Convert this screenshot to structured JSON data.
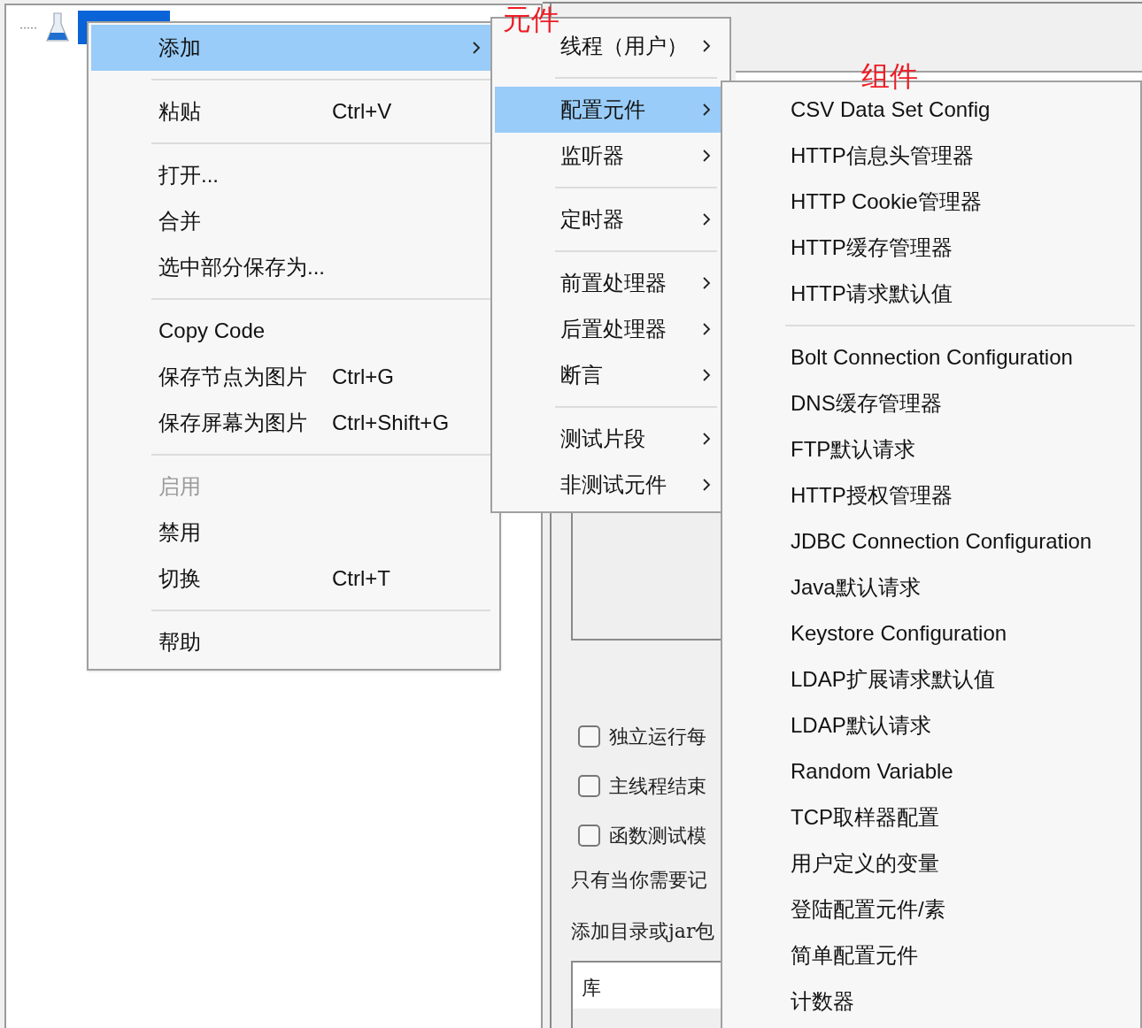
{
  "tree": {
    "connector": "·····",
    "node_selected": true
  },
  "annotations": [
    {
      "text": "元件"
    },
    {
      "text": "组件"
    }
  ],
  "settings_panel": {
    "checkboxes": [
      {
        "label": "独立运行每",
        "checked": false
      },
      {
        "label": "主线程结束",
        "checked": false
      },
      {
        "label": "函数测试模",
        "checked": false
      }
    ],
    "note": "只有当你需要记",
    "library_label": "添加目录或jar包",
    "library_columns": [
      "库"
    ]
  },
  "context_menu": {
    "items": [
      {
        "kind": "item",
        "label": "添加",
        "submenu": true,
        "selected": true,
        "disabled": false
      },
      {
        "kind": "separator"
      },
      {
        "kind": "item",
        "label": "粘贴",
        "shortcut": "Ctrl+V",
        "submenu": false,
        "selected": false,
        "disabled": false
      },
      {
        "kind": "separator"
      },
      {
        "kind": "item",
        "label": "打开...",
        "submenu": false,
        "selected": false,
        "disabled": false
      },
      {
        "kind": "item",
        "label": "合并",
        "submenu": false,
        "selected": false,
        "disabled": false
      },
      {
        "kind": "item",
        "label": "选中部分保存为...",
        "submenu": false,
        "selected": false,
        "disabled": false
      },
      {
        "kind": "separator"
      },
      {
        "kind": "item",
        "label": "Copy Code",
        "submenu": false,
        "selected": false,
        "disabled": false
      },
      {
        "kind": "item",
        "label": "保存节点为图片",
        "shortcut": "Ctrl+G",
        "submenu": false,
        "selected": false,
        "disabled": false
      },
      {
        "kind": "item",
        "label": "保存屏幕为图片",
        "shortcut": "Ctrl+Shift+G",
        "submenu": false,
        "selected": false,
        "disabled": false
      },
      {
        "kind": "separator"
      },
      {
        "kind": "item",
        "label": "启用",
        "submenu": false,
        "selected": false,
        "disabled": true
      },
      {
        "kind": "item",
        "label": "禁用",
        "submenu": false,
        "selected": false,
        "disabled": false
      },
      {
        "kind": "item",
        "label": "切换",
        "shortcut": "Ctrl+T",
        "submenu": false,
        "selected": false,
        "disabled": false
      },
      {
        "kind": "separator"
      },
      {
        "kind": "item",
        "label": "帮助",
        "submenu": false,
        "selected": false,
        "disabled": false
      }
    ]
  },
  "add_submenu": {
    "items": [
      {
        "kind": "item",
        "label": "线程（用户）",
        "submenu": true,
        "selected": false
      },
      {
        "kind": "separator"
      },
      {
        "kind": "item",
        "label": "配置元件",
        "submenu": true,
        "selected": true
      },
      {
        "kind": "item",
        "label": "监听器",
        "submenu": true,
        "selected": false
      },
      {
        "kind": "separator"
      },
      {
        "kind": "item",
        "label": "定时器",
        "submenu": true,
        "selected": false
      },
      {
        "kind": "separator"
      },
      {
        "kind": "item",
        "label": "前置处理器",
        "submenu": true,
        "selected": false
      },
      {
        "kind": "item",
        "label": "后置处理器",
        "submenu": true,
        "selected": false
      },
      {
        "kind": "item",
        "label": "断言",
        "submenu": true,
        "selected": false
      },
      {
        "kind": "separator"
      },
      {
        "kind": "item",
        "label": "测试片段",
        "submenu": true,
        "selected": false
      },
      {
        "kind": "item",
        "label": "非测试元件",
        "submenu": true,
        "selected": false
      }
    ]
  },
  "config_submenu": {
    "items": [
      {
        "kind": "item",
        "label": "CSV Data Set Config",
        "selected": false
      },
      {
        "kind": "item",
        "label": "HTTP信息头管理器",
        "selected": false
      },
      {
        "kind": "item",
        "label": "HTTP Cookie管理器",
        "selected": false
      },
      {
        "kind": "item",
        "label": "HTTP缓存管理器",
        "selected": false
      },
      {
        "kind": "item",
        "label": "HTTP请求默认值",
        "selected": false
      },
      {
        "kind": "separator"
      },
      {
        "kind": "item",
        "label": "Bolt Connection Configuration",
        "selected": false
      },
      {
        "kind": "item",
        "label": "DNS缓存管理器",
        "selected": false
      },
      {
        "kind": "item",
        "label": "FTP默认请求",
        "selected": false
      },
      {
        "kind": "item",
        "label": "HTTP授权管理器",
        "selected": false
      },
      {
        "kind": "item",
        "label": "JDBC Connection Configuration",
        "selected": false
      },
      {
        "kind": "item",
        "label": "Java默认请求",
        "selected": false
      },
      {
        "kind": "item",
        "label": "Keystore Configuration",
        "selected": false
      },
      {
        "kind": "item",
        "label": "LDAP扩展请求默认值",
        "selected": false
      },
      {
        "kind": "item",
        "label": "LDAP默认请求",
        "selected": false
      },
      {
        "kind": "item",
        "label": "Random Variable",
        "selected": false
      },
      {
        "kind": "item",
        "label": "TCP取样器配置",
        "selected": false
      },
      {
        "kind": "item",
        "label": "用户定义的变量",
        "selected": false
      },
      {
        "kind": "item",
        "label": "登陆配置元件/素",
        "selected": false
      },
      {
        "kind": "item",
        "label": "简单配置元件",
        "selected": false
      },
      {
        "kind": "item",
        "label": "计数器",
        "selected": false
      }
    ]
  }
}
